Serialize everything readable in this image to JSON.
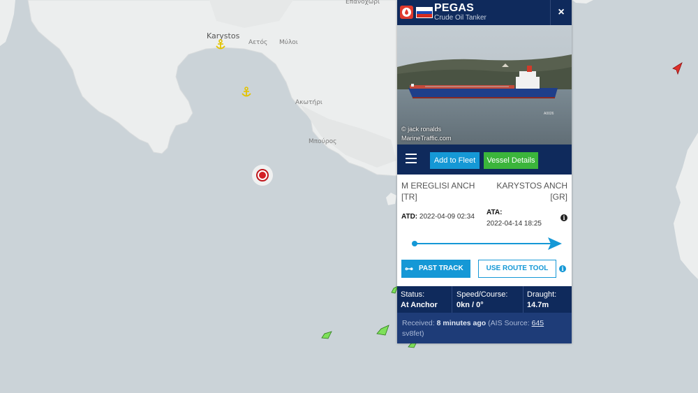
{
  "map": {
    "labels": {
      "karystos": "Karystos",
      "aetos": "Αετός",
      "myli": "Μύλοι",
      "akotiri": "Ακωτήρι",
      "mylos": "Μπούρος",
      "epanochori": "Επάνοχώρι"
    }
  },
  "vessel": {
    "name": "PEGAS",
    "type": "Crude Oil Tanker",
    "flag_colors": [
      "#ffffff",
      "#1c4bb8",
      "#d52b1e"
    ],
    "photo_credit_line1": "© jack ronalds",
    "photo_credit_line2": "MarineTraffic.com",
    "photo_tag": "A0026"
  },
  "actions": {
    "close_glyph": "×",
    "menu_icon": "hamburger-icon",
    "add_to_fleet": "Add to Fleet",
    "vessel_details": "Vessel Details",
    "past_track": "PAST TRACK",
    "past_track_glyph": "⊶",
    "route_tool": "USE ROUTE TOOL",
    "info_glyph": "i"
  },
  "voyage": {
    "departure_port": "M EREGLISI ANCH",
    "departure_country": "[TR]",
    "arrival_port": "KARYSTOS ANCH",
    "arrival_country": "[GR]",
    "atd_label": "ATD:",
    "atd_value": "2022-04-09 02:34",
    "ata_label": "ATA:",
    "ata_value": "2022-04-14 18:25"
  },
  "status": {
    "status_label": "Status:",
    "status_value": "At Anchor",
    "speed_label": "Speed/Course:",
    "speed_value": "0kn / 0°",
    "draught_label": "Draught:",
    "draught_value": "14.7m"
  },
  "received": {
    "label": "Received:",
    "time": "8 minutes ago",
    "source_prefix": "(AIS Source:",
    "source_id": "645",
    "source_name": "sv8fet)"
  },
  "colors": {
    "header_navy": "#0f2a5c",
    "accent_blue": "#1598d6",
    "accent_green": "#3bb53b",
    "brand_red": "#e03a2d"
  }
}
